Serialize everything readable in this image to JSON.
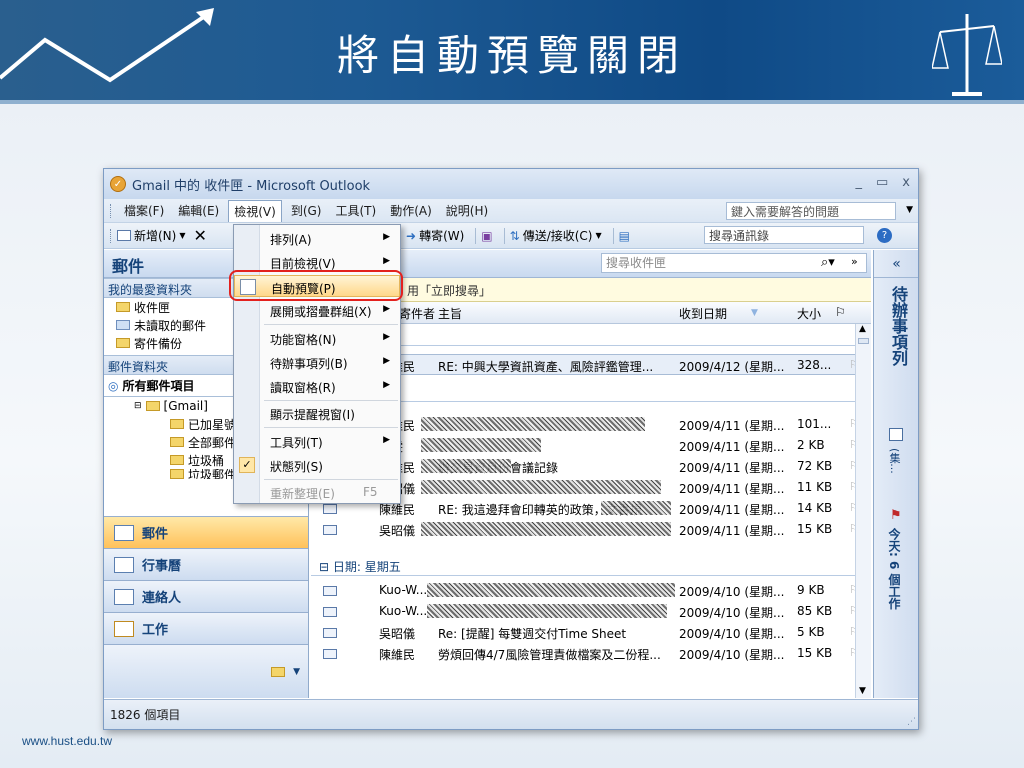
{
  "slide": {
    "title": "將自動預覽關閉",
    "footer_url": "www.hust.edu.tw"
  },
  "window": {
    "title": "Gmail 中的 收件匣 - Microsoft Outlook",
    "controls": {
      "minimize": "_",
      "maximize": "▭",
      "close": "x"
    }
  },
  "menubar": {
    "items": [
      "檔案(F)",
      "編輯(E)",
      "檢視(V)",
      "到(G)",
      "工具(T)",
      "動作(A)",
      "說明(H)"
    ],
    "help_box": "鍵入需要解答的問題"
  },
  "toolbar": {
    "new_label": "新增(N)",
    "forward_label": "轉寄(W)",
    "send_receive_label": "傳送/接收(C)",
    "search_box": "搜尋通訊錄"
  },
  "nav": {
    "header": "郵件",
    "favorites_header": "我的最愛資料夾",
    "favorites": [
      "收件匣",
      "未讀取的郵件",
      "寄件備份"
    ],
    "folders_header": "郵件資料夾",
    "all_items": "所有郵件項目",
    "gmail": "[Gmail]",
    "gmail_children": [
      "已加星號",
      "全部郵件",
      "垃圾桶",
      "垃圾郵件"
    ],
    "buttons": [
      "郵件",
      "行事曆",
      "連絡人",
      "工作"
    ]
  },
  "mail": {
    "search_placeholder": "搜尋收件匣",
    "info_bar": "用「立即搜尋」",
    "col_from": "寄件者",
    "col_subject": "主旨",
    "col_received": "收到日期",
    "col_size": "大小",
    "selected_row": {
      "from": "陳維民",
      "subject": "RE: 中興大學資訊資產、風險評鑑管理...",
      "date": "2009/4/12 (星期...",
      "size": "328..."
    },
    "rows_day1": [
      {
        "from": "陳維民",
        "subject": "",
        "date": "2009/4/11 (星期...",
        "size": "101..."
      },
      {
        "from": "陳雯",
        "subject": "",
        "date": "2009/4/11 (星期...",
        "size": "2 KB"
      },
      {
        "from": "陳維民",
        "subject": "辦交易資月份會議記錄",
        "date": "2009/4/11 (星期...",
        "size": "72 KB"
      },
      {
        "from": "吳昭儀",
        "subject": "",
        "date": "2009/4/11 (星期...",
        "size": "11 KB"
      },
      {
        "from": "陳維民",
        "subject": "RE: 我這邊拜會印轉英的政策，文書規",
        "date": "2009/4/11 (星期...",
        "size": "14 KB"
      },
      {
        "from": "吳昭儀",
        "subject": "",
        "date": "2009/4/11 (星期...",
        "size": "15 KB"
      }
    ],
    "group_label": "日期: 星期五",
    "rows_day2": [
      {
        "from": "Kuo-W...",
        "subject": "",
        "date": "2009/4/10 (星期...",
        "size": "9 KB"
      },
      {
        "from": "Kuo-W...",
        "subject": "",
        "date": "2009/4/10 (星期...",
        "size": "85 KB"
      },
      {
        "from": "吳昭儀",
        "subject": "Re: [提醒] 每雙週交付Time Sheet",
        "date": "2009/4/10 (星期...",
        "size": "5 KB"
      },
      {
        "from": "陳維民",
        "subject": "勞煩回傳4/7風險管理責做檔案及二份程...",
        "date": "2009/4/10 (星期...",
        "size": "15 KB"
      }
    ]
  },
  "todo": {
    "collapse": "«",
    "title": "待辦事項列",
    "calendar_label": "(集...",
    "tasks_label": "今天: 6 個工作"
  },
  "status": {
    "items_count": "1826 個項目"
  },
  "dropdown": {
    "items": [
      {
        "label": "排列(A)",
        "submenu": true
      },
      {
        "label": "目前檢視(V)",
        "submenu": true
      },
      {
        "label": "自動預覽(P)",
        "submenu": false,
        "highlighted": true
      },
      {
        "label": "展開或摺疊群組(X)",
        "submenu": true
      },
      {
        "label": "功能窗格(N)",
        "submenu": true
      },
      {
        "label": "待辦事項列(B)",
        "submenu": true
      },
      {
        "label": "讀取窗格(R)",
        "submenu": true
      },
      {
        "label": "顯示提醒視窗(I)",
        "submenu": false
      },
      {
        "label": "工具列(T)",
        "submenu": true
      },
      {
        "label": "狀態列(S)",
        "submenu": false,
        "checked": true
      },
      {
        "label": "重新整理(E)",
        "shortcut": "F5",
        "disabled": true
      }
    ]
  },
  "colors": {
    "accent": "#15437a",
    "highlight": "#e3211e",
    "header_blue": "#1d5a93"
  }
}
